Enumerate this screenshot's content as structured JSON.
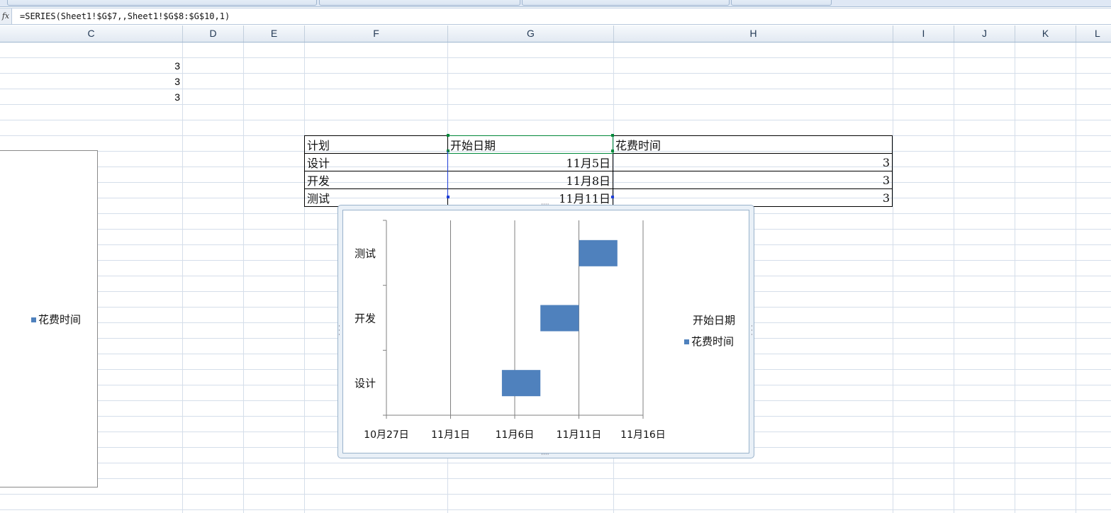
{
  "ribbon": {
    "tabs": [
      "",
      "",
      "",
      ""
    ]
  },
  "formula_bar": {
    "fx_label": "fx",
    "formula": "=SERIES(Sheet1!$G$7,,Sheet1!$G$8:$G$10,1)"
  },
  "columns": [
    "C",
    "D",
    "E",
    "F",
    "G",
    "H",
    "I",
    "J",
    "K",
    "L"
  ],
  "column_c_values": [
    "3",
    "3",
    "3"
  ],
  "table": {
    "headers": [
      "计划",
      "开始日期",
      "花费时间"
    ],
    "rows": [
      {
        "plan": "设计",
        "start": "11月5日",
        "duration": "3"
      },
      {
        "plan": "开发",
        "start": "11月8日",
        "duration": "3"
      },
      {
        "plan": "测试",
        "start": "11月11日",
        "duration": "3"
      }
    ]
  },
  "left_chart": {
    "legend": "花费时间"
  },
  "chart_data": {
    "type": "bar",
    "orientation": "horizontal-stacked",
    "categories": [
      "设计",
      "开发",
      "测试"
    ],
    "series": [
      {
        "name": "开始日期",
        "values": [
          "11月5日",
          "11月8日",
          "11月11日"
        ],
        "visible": false
      },
      {
        "name": "花费时间",
        "values": [
          3,
          3,
          3
        ],
        "color": "#4f81bd"
      }
    ],
    "x_ticks": [
      "10月27日",
      "11月1日",
      "11月6日",
      "11月11日",
      "11月16日"
    ],
    "xlim": [
      "10月27日",
      "11月16日"
    ],
    "grid": "vertical major gridlines",
    "legend_position": "right",
    "legend": {
      "title": "开始日期",
      "item": "花费时间"
    }
  },
  "colors": {
    "accent_bar": "#4f81bd",
    "selection": "#00883a"
  }
}
